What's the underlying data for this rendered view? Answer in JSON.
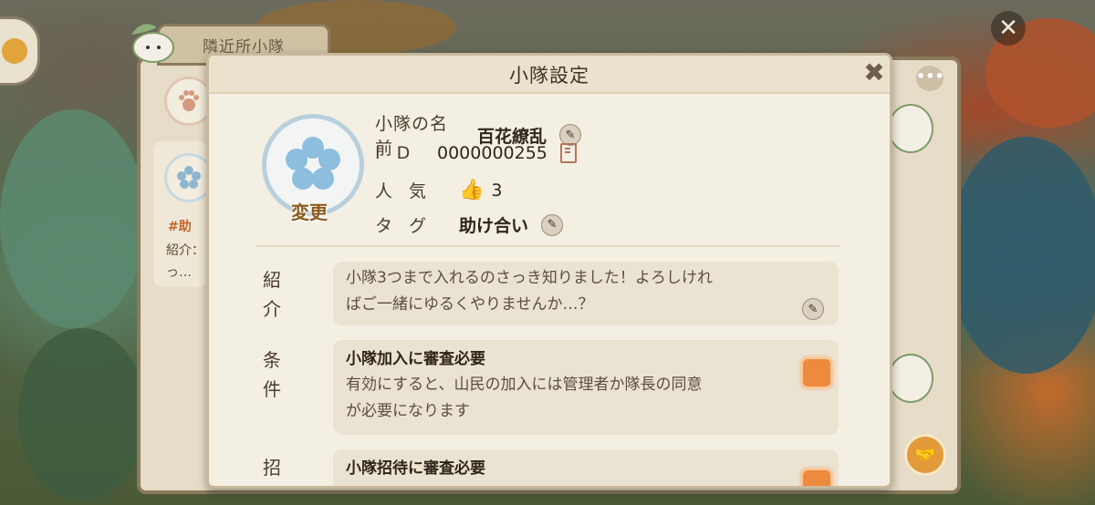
{
  "background": {
    "rear_panel_tab": "隣近所小隊",
    "rear_card_tag": "#助",
    "rear_card_line1": "紹介：",
    "rear_card_line2": "っ…",
    "more_icon": "more-dots-icon"
  },
  "modal": {
    "title": "小隊設定",
    "close_icon": "close-icon",
    "change_label": "変更",
    "name_key": "小隊の名前",
    "name_value": "百花繚乱",
    "id_key": "I D",
    "id_value": "0000000255",
    "popularity_key": "人 気",
    "popularity_value": "3",
    "tag_key": "タ グ",
    "tag_value": "助け合い"
  },
  "intro": {
    "label_1": "紹",
    "label_2": "介",
    "line1": "小隊3つまで入れるのさっき知りました！よろしけれ",
    "line2": "ばご一緒にゆるくやりませんか…？"
  },
  "condition": {
    "label_1": "条",
    "label_2": "件",
    "title": "小隊加入に審査必要",
    "line1": "有効にすると、山民の加入には管理者か隊長の同意",
    "line2": "が必要になります",
    "toggle_on": true
  },
  "invite": {
    "label_1": "招",
    "title": "小隊招待に審査必要"
  },
  "colors": {
    "accent_orange": "#ee8a3c",
    "panel": "#f4efe3"
  }
}
